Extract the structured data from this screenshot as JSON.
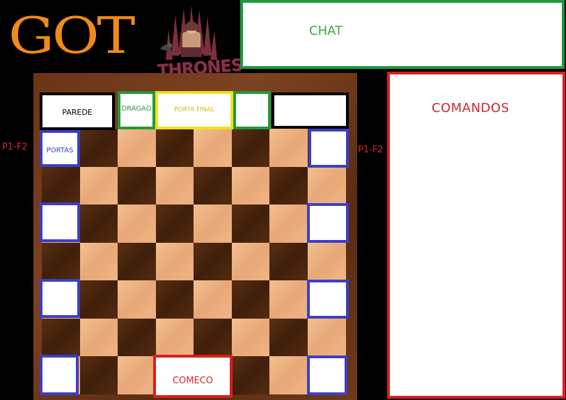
{
  "header": {
    "logo_text": "GOT",
    "emblem_text": "THRONES"
  },
  "chat": {
    "label": "CHAT"
  },
  "commands": {
    "label": "COMANDOS"
  },
  "board": {
    "wall_label": "PAREDE",
    "dragon_label": "DRAGAO",
    "final_door_label": "PORTA FINAL",
    "doors_label": "PORTAS",
    "start_label": "COMECO",
    "floor_label_left": "P1-F2",
    "floor_label_right": "P1-F2"
  },
  "colors": {
    "logo": "#f08a1a",
    "chat_border": "#1f9a3a",
    "commands_border": "#e01c1c",
    "door_border": "#3b3fc4",
    "final_door_border": "#f2e11b",
    "dragon_border": "#1f9a3a",
    "start_border": "#e01c1c"
  }
}
